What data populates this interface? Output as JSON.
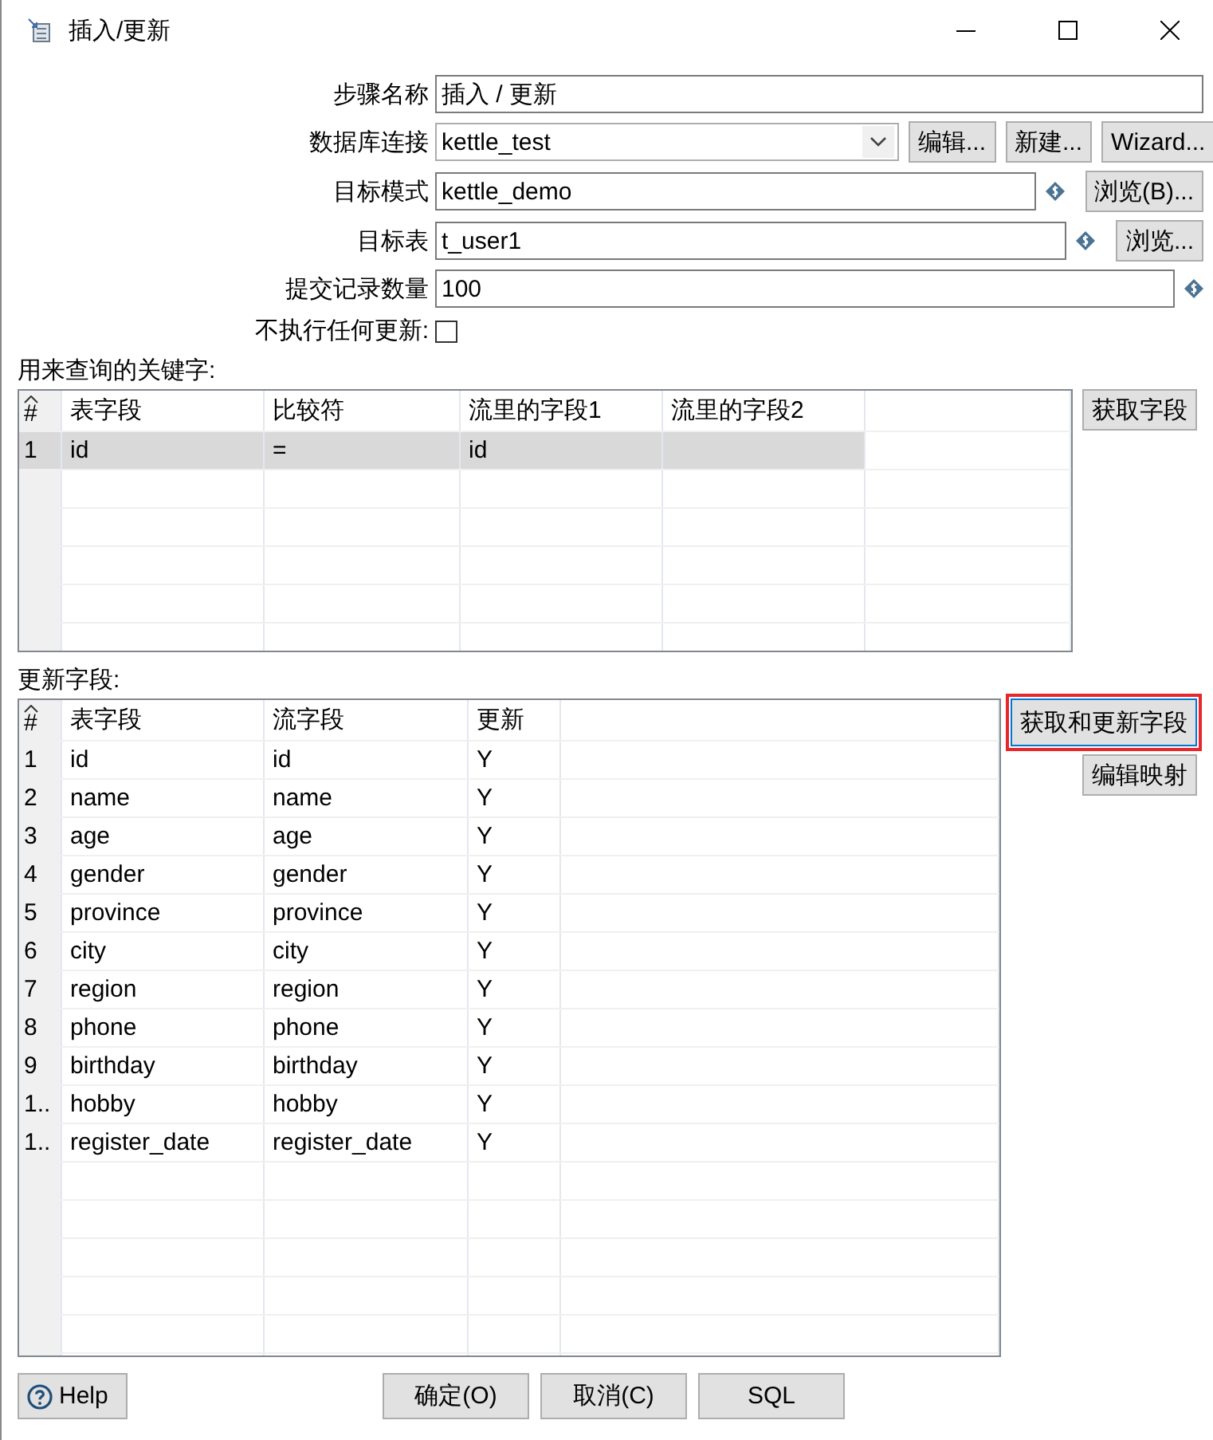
{
  "window": {
    "title": "插入/更新"
  },
  "form": [
    {
      "kind": "text",
      "label": "步骤名称",
      "value": "插入 / 更新",
      "variable": false
    },
    {
      "kind": "combo",
      "label": "数据库连接",
      "value": "kettle_test",
      "variable": false,
      "buttons": [
        "编辑...",
        "新建...",
        "Wizard..."
      ]
    },
    {
      "kind": "text",
      "label": "目标模式",
      "value": "kettle_demo",
      "variable": true,
      "buttons": [
        "浏览(B)..."
      ]
    },
    {
      "kind": "text",
      "label": "目标表",
      "value": "t_user1",
      "variable": true,
      "buttons": [
        "浏览..."
      ]
    },
    {
      "kind": "text",
      "label": "提交记录数量",
      "value": "100",
      "variable": true
    },
    {
      "kind": "checkbox",
      "label": "不执行任何更新:",
      "checked": false
    }
  ],
  "keys": {
    "label": "用来查询的关键字:",
    "columns": [
      "#",
      "表字段",
      "比较符",
      "流里的字段1",
      "流里的字段2"
    ],
    "rows": [
      {
        "cells": [
          "1",
          "id",
          "=",
          "id",
          ""
        ],
        "selected": true
      }
    ],
    "buttons": [
      {
        "label": "获取字段",
        "highlighted": false
      }
    ]
  },
  "updates": {
    "label": "更新字段:",
    "columns": [
      "#",
      "表字段",
      "流字段",
      "更新"
    ],
    "rows": [
      {
        "cells": [
          "1",
          "id",
          "id",
          "Y"
        ],
        "selected": false
      },
      {
        "cells": [
          "2",
          "name",
          "name",
          "Y"
        ],
        "selected": false
      },
      {
        "cells": [
          "3",
          "age",
          "age",
          "Y"
        ],
        "selected": false
      },
      {
        "cells": [
          "4",
          "gender",
          "gender",
          "Y"
        ],
        "selected": false
      },
      {
        "cells": [
          "5",
          "province",
          "province",
          "Y"
        ],
        "selected": false
      },
      {
        "cells": [
          "6",
          "city",
          "city",
          "Y"
        ],
        "selected": false
      },
      {
        "cells": [
          "7",
          "region",
          "region",
          "Y"
        ],
        "selected": false
      },
      {
        "cells": [
          "8",
          "phone",
          "phone",
          "Y"
        ],
        "selected": false
      },
      {
        "cells": [
          "9",
          "birthday",
          "birthday",
          "Y"
        ],
        "selected": false
      },
      {
        "cells": [
          "1..",
          "hobby",
          "hobby",
          "Y"
        ],
        "selected": false
      },
      {
        "cells": [
          "1..",
          "register_date",
          "register_date",
          "Y"
        ],
        "selected": false
      }
    ],
    "buttons": [
      {
        "label": "获取和更新字段",
        "highlighted": true
      },
      {
        "label": "编辑映射",
        "highlighted": false
      }
    ]
  },
  "footer": {
    "help": "Help",
    "buttons": [
      "确定(O)",
      "取消(C)",
      "SQL"
    ]
  }
}
